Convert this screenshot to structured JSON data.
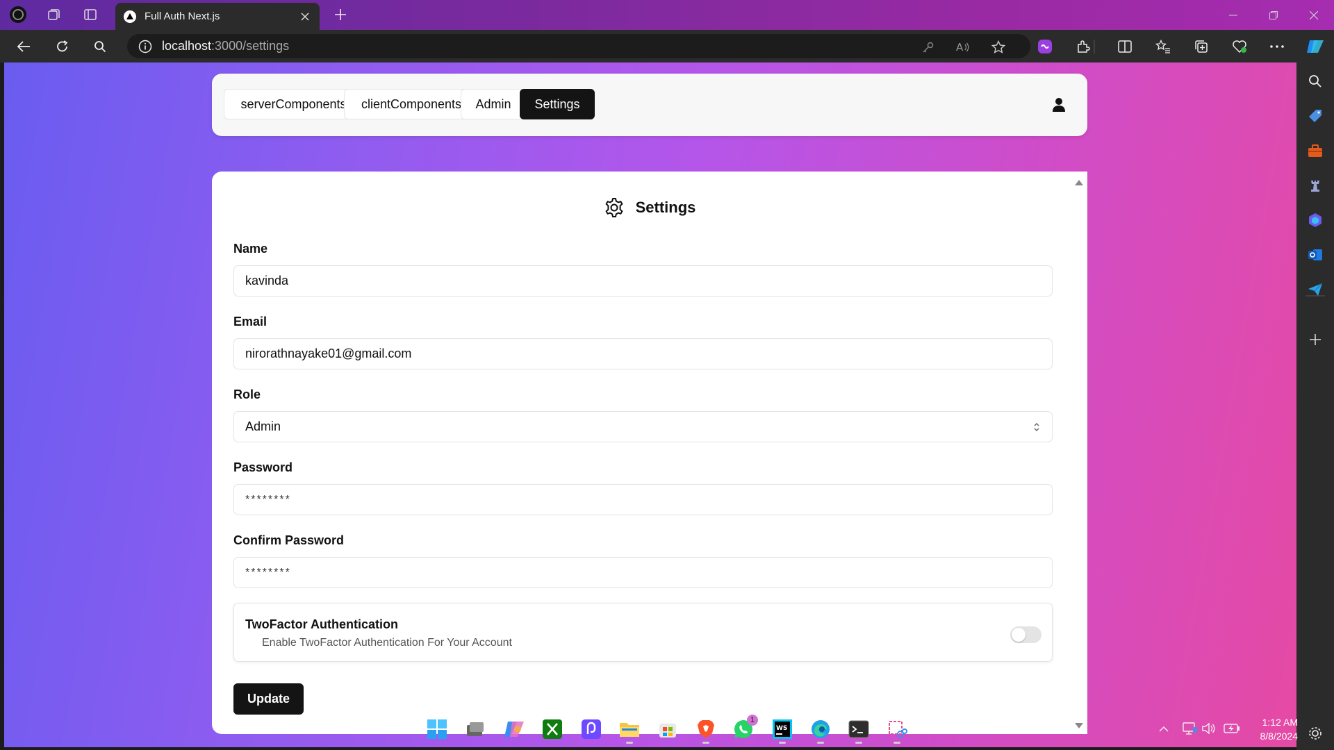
{
  "browser": {
    "tab_title": "Full Auth Next.js",
    "url_host": "localhost",
    "url_path": ":3000/settings"
  },
  "nav": {
    "items": [
      {
        "label": "serverComponents",
        "active": false
      },
      {
        "label": "clientComponents",
        "active": false
      },
      {
        "label": "Admin",
        "active": false
      },
      {
        "label": "Settings",
        "active": true
      }
    ]
  },
  "settings": {
    "title": "Settings",
    "fields": {
      "name": {
        "label": "Name",
        "value": "kavinda"
      },
      "email": {
        "label": "Email",
        "value": "nirorathnayake01@gmail.com"
      },
      "role": {
        "label": "Role",
        "value": "Admin"
      },
      "password": {
        "label": "Password",
        "placeholder": "********"
      },
      "confirm_password": {
        "label": "Confirm Password",
        "placeholder": "********"
      }
    },
    "two_factor": {
      "title": "TwoFactor Authentication",
      "description": "Enable TwoFactor Authentication For Your Account",
      "enabled": false
    },
    "update_label": "Update"
  },
  "taskbar": {
    "whatsapp_badge": "1",
    "time": "1:12 AM",
    "date": "8/8/2024"
  },
  "colors": {
    "gradient_start": "#6a5cf0",
    "gradient_end": "#e54aa4",
    "primary_button": "#141414"
  }
}
